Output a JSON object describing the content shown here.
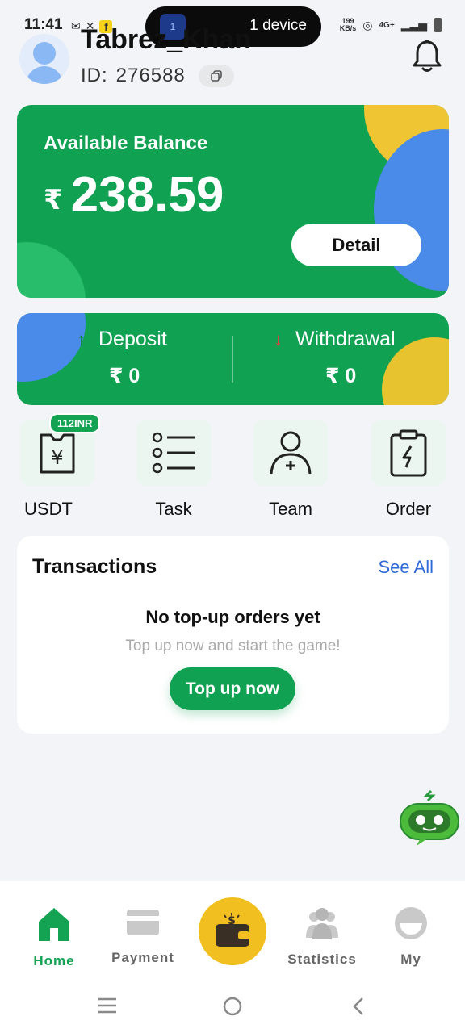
{
  "status_bar": {
    "time": "11:41",
    "network_speed_top": "199",
    "network_speed_bottom": "KB/s",
    "network_type": "4G+",
    "island_icon_text": "1",
    "island_text": "1 device"
  },
  "header": {
    "username": "Tabrez_Khan",
    "id_label": "ID:",
    "id_value": "276588"
  },
  "balance": {
    "label": "Available Balance",
    "currency": "₹",
    "amount": "238.59",
    "detail_label": "Detail"
  },
  "funds": {
    "deposit_label": "Deposit",
    "deposit_value": "₹ 0",
    "withdrawal_label": "Withdrawal",
    "withdrawal_value": "₹ 0"
  },
  "quick_actions": {
    "usdt_label": "USDT",
    "usdt_badge": "112INR",
    "task_label": "Task",
    "team_label": "Team",
    "order_label": "Order"
  },
  "transactions": {
    "title": "Transactions",
    "see_all": "See All",
    "empty_title": "No top-up orders yet",
    "empty_subtitle": "Top up now and start the game!",
    "topup_label": "Top up now"
  },
  "bottom_nav": {
    "home": "Home",
    "payment": "Payment",
    "statistics": "Statistics",
    "my": "My"
  },
  "colors": {
    "primary_green": "#11a153",
    "accent_yellow": "#f0c533",
    "accent_blue": "#4a8ae9",
    "link_blue": "#2e6bd6"
  },
  "icons": {
    "wallet": "wallet-icon",
    "robot": "robot-assistant-icon"
  }
}
